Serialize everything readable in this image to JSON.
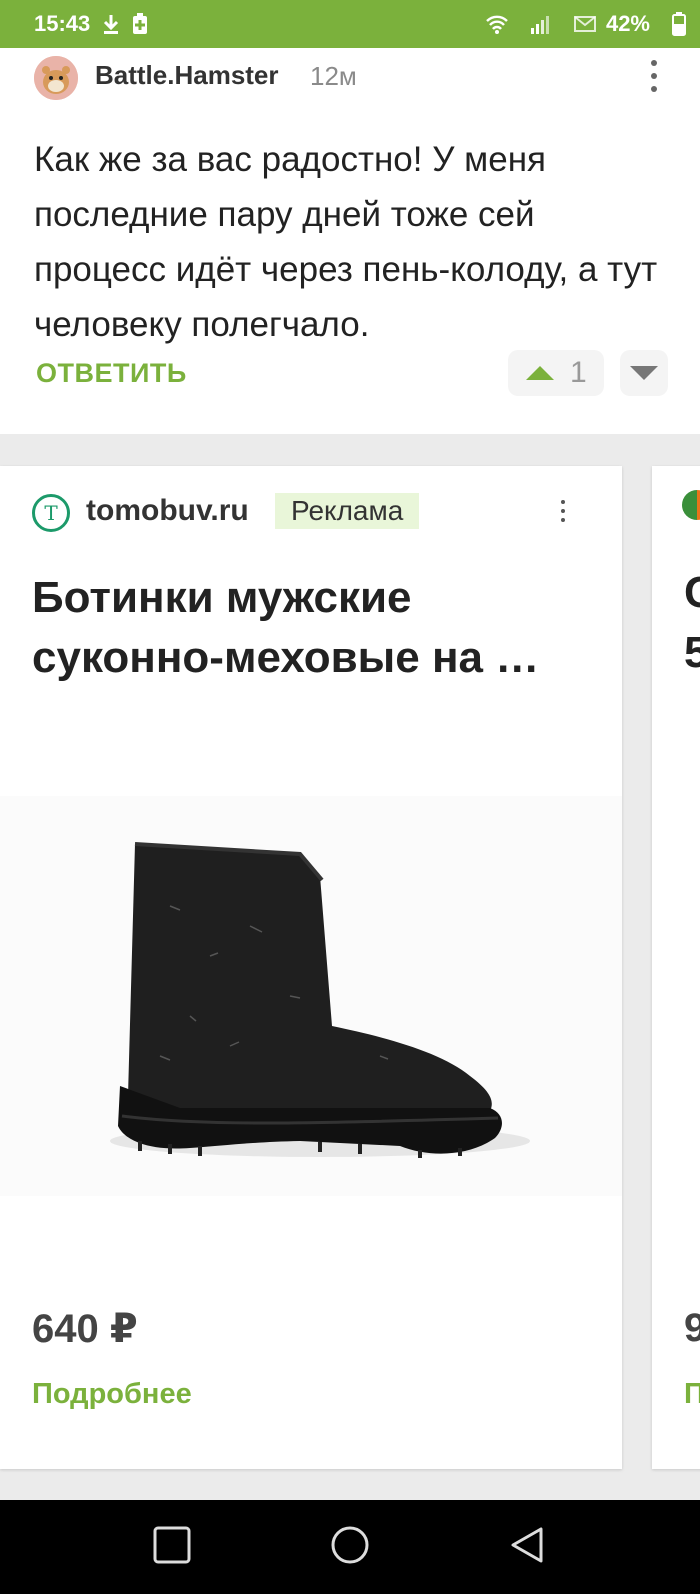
{
  "status_bar": {
    "time": "15:43",
    "battery": "42%"
  },
  "comment": {
    "author": "Battle.Hamster",
    "time": "12м",
    "text": "Как же за вас радостно! У меня последние пару дней тоже сей процесс идёт через пень-колоду, а тут человеку полегчало.",
    "reply_label": "ОТВЕТИТЬ",
    "rating": "1"
  },
  "ad": {
    "logo_letter": "T",
    "domain": "tomobuv.ru",
    "badge": "Реклама",
    "title": "Ботинки мужские суконно-меховые на …",
    "price": "640 ₽",
    "more_label": "Подробнее"
  },
  "ad_next": {
    "title_line1": "С",
    "title_line2": "5",
    "price": "9",
    "more_label": "П"
  },
  "colors": {
    "accent": "#7bb13c",
    "status_bar": "#7bb13c",
    "ad_badge_bg": "#e9f6d9"
  }
}
